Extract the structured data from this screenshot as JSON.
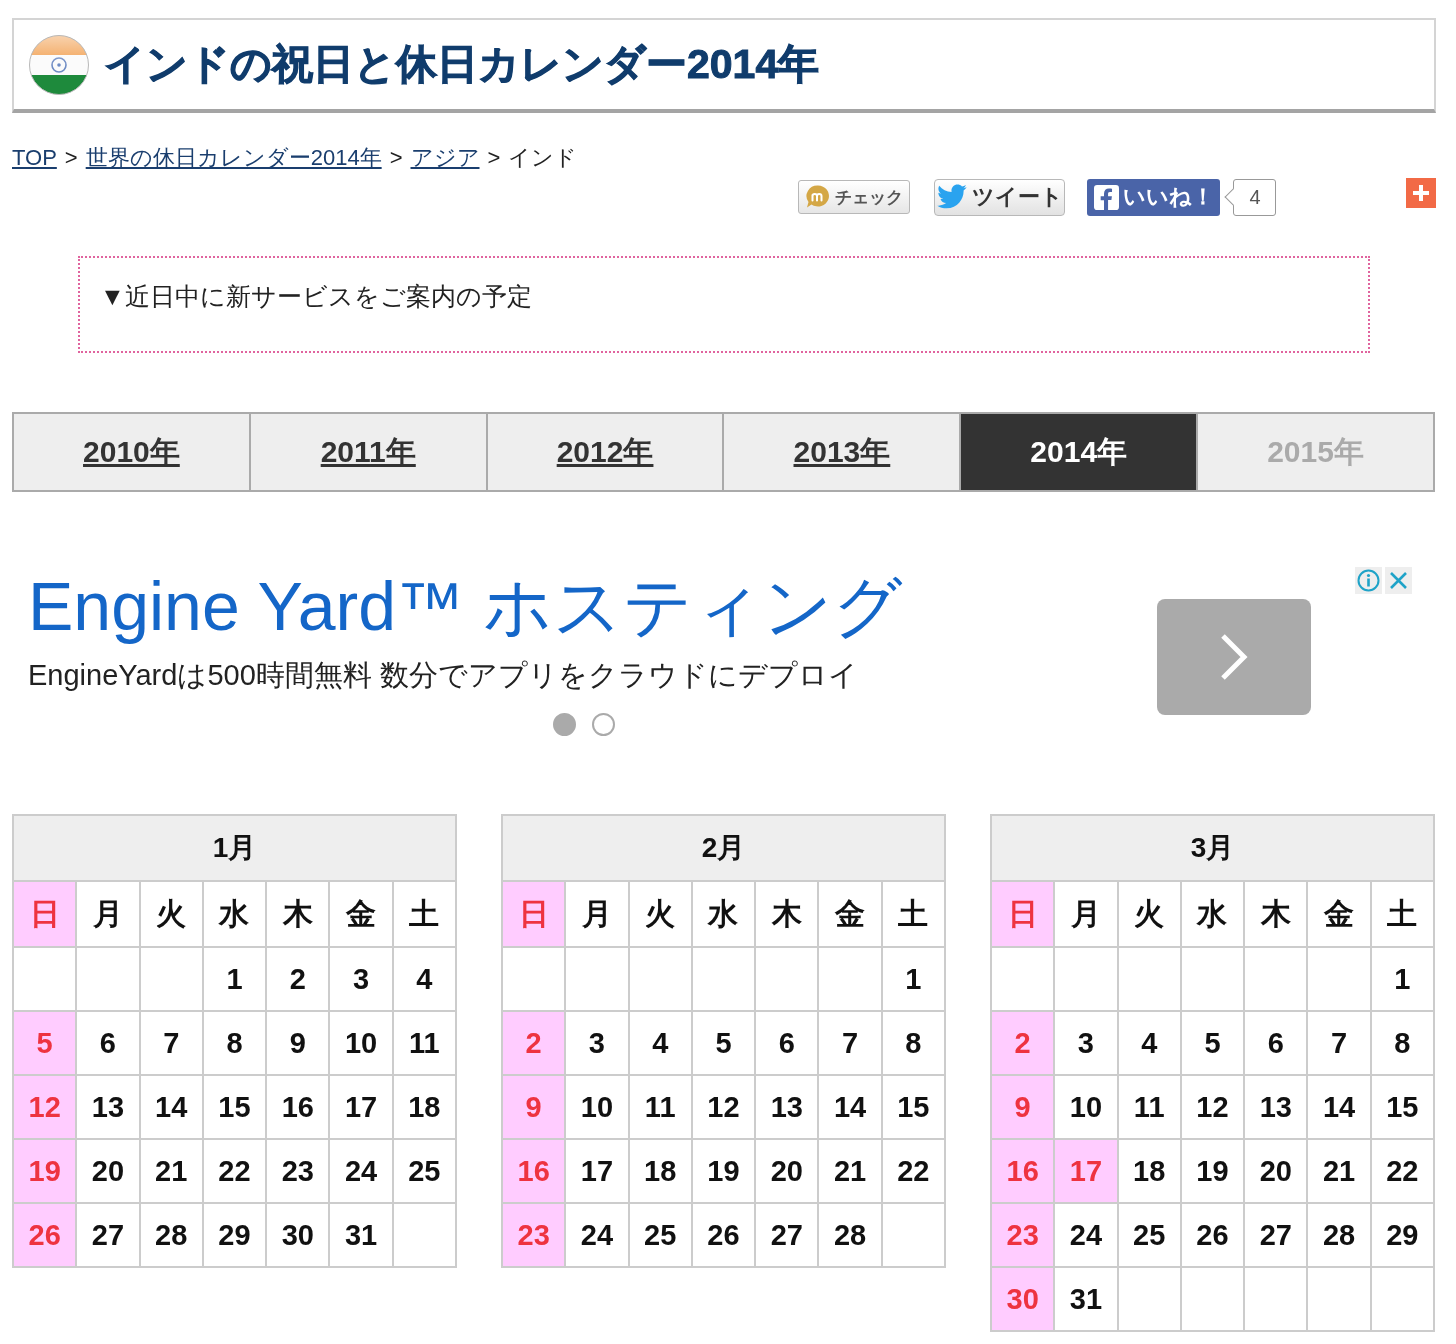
{
  "header": {
    "title": "インドの祝日と休日カレンダー2014年"
  },
  "breadcrumb": [
    {
      "label": "TOP",
      "kind": "link"
    },
    {
      "label": ">",
      "kind": "separator"
    },
    {
      "label": "世界の休日カレンダー2014年",
      "kind": "link"
    },
    {
      "label": ">",
      "kind": "separator"
    },
    {
      "label": "アジア",
      "kind": "link"
    },
    {
      "label": ">",
      "kind": "separator"
    },
    {
      "label": "インド",
      "kind": "current"
    }
  ],
  "share": {
    "buttons": [
      {
        "label": "チェック",
        "kind": "check"
      },
      {
        "label": "ツイート",
        "kind": "tweet"
      },
      {
        "label": "いいね！",
        "kind": "like"
      }
    ],
    "like_count": "4"
  },
  "notice": {
    "text": "▼近日中に新サービスをご案内の予定"
  },
  "year_tabs": [
    {
      "label": "2010年",
      "selected": false,
      "disabled": false
    },
    {
      "label": "2011年",
      "selected": false,
      "disabled": false
    },
    {
      "label": "2012年",
      "selected": false,
      "disabled": false
    },
    {
      "label": "2013年",
      "selected": false,
      "disabled": false
    },
    {
      "label": "2014年",
      "selected": true,
      "disabled": false
    },
    {
      "label": "2015年",
      "selected": false,
      "disabled": true
    }
  ],
  "ad": {
    "title": "Engine Yard™ ホスティング",
    "description": "EngineYardは500時間無料 数分でアプリをクラウドにデプロイ",
    "slides": [
      {
        "selected": true
      },
      {
        "selected": false
      }
    ]
  },
  "months": [
    {
      "title": "1月",
      "weekdays": [
        {
          "label": "日",
          "holiday": true
        },
        {
          "label": "月",
          "holiday": false
        },
        {
          "label": "火",
          "holiday": false
        },
        {
          "label": "水",
          "holiday": false
        },
        {
          "label": "木",
          "holiday": false
        },
        {
          "label": "金",
          "holiday": false
        },
        {
          "label": "土",
          "holiday": false
        }
      ],
      "weeks": [
        [
          {
            "kind": "blank"
          },
          {
            "kind": "blank"
          },
          {
            "kind": "blank"
          },
          {
            "kind": "day",
            "day": "1",
            "holiday": false
          },
          {
            "kind": "day",
            "day": "2",
            "holiday": false
          },
          {
            "kind": "day",
            "day": "3",
            "holiday": false
          },
          {
            "kind": "day",
            "day": "4",
            "holiday": false
          }
        ],
        [
          {
            "kind": "day",
            "day": "5",
            "holiday": true
          },
          {
            "kind": "day",
            "day": "6",
            "holiday": false
          },
          {
            "kind": "day",
            "day": "7",
            "holiday": false
          },
          {
            "kind": "day",
            "day": "8",
            "holiday": false
          },
          {
            "kind": "day",
            "day": "9",
            "holiday": false
          },
          {
            "kind": "day",
            "day": "10",
            "holiday": false
          },
          {
            "kind": "day",
            "day": "11",
            "holiday": false
          }
        ],
        [
          {
            "kind": "day",
            "day": "12",
            "holiday": true
          },
          {
            "kind": "day",
            "day": "13",
            "holiday": false
          },
          {
            "kind": "day",
            "day": "14",
            "holiday": false
          },
          {
            "kind": "day",
            "day": "15",
            "holiday": false
          },
          {
            "kind": "day",
            "day": "16",
            "holiday": false
          },
          {
            "kind": "day",
            "day": "17",
            "holiday": false
          },
          {
            "kind": "day",
            "day": "18",
            "holiday": false
          }
        ],
        [
          {
            "kind": "day",
            "day": "19",
            "holiday": true
          },
          {
            "kind": "day",
            "day": "20",
            "holiday": false
          },
          {
            "kind": "day",
            "day": "21",
            "holiday": false
          },
          {
            "kind": "day",
            "day": "22",
            "holiday": false
          },
          {
            "kind": "day",
            "day": "23",
            "holiday": false
          },
          {
            "kind": "day",
            "day": "24",
            "holiday": false
          },
          {
            "kind": "day",
            "day": "25",
            "holiday": false
          }
        ],
        [
          {
            "kind": "day",
            "day": "26",
            "holiday": true
          },
          {
            "kind": "day",
            "day": "27",
            "holiday": false
          },
          {
            "kind": "day",
            "day": "28",
            "holiday": false
          },
          {
            "kind": "day",
            "day": "29",
            "holiday": false
          },
          {
            "kind": "day",
            "day": "30",
            "holiday": false
          },
          {
            "kind": "day",
            "day": "31",
            "holiday": false
          },
          {
            "kind": "blank"
          }
        ]
      ]
    },
    {
      "title": "2月",
      "weekdays": [
        {
          "label": "日",
          "holiday": true
        },
        {
          "label": "月",
          "holiday": false
        },
        {
          "label": "火",
          "holiday": false
        },
        {
          "label": "水",
          "holiday": false
        },
        {
          "label": "木",
          "holiday": false
        },
        {
          "label": "金",
          "holiday": false
        },
        {
          "label": "土",
          "holiday": false
        }
      ],
      "weeks": [
        [
          {
            "kind": "blank"
          },
          {
            "kind": "blank"
          },
          {
            "kind": "blank"
          },
          {
            "kind": "blank"
          },
          {
            "kind": "blank"
          },
          {
            "kind": "blank"
          },
          {
            "kind": "day",
            "day": "1",
            "holiday": false
          }
        ],
        [
          {
            "kind": "day",
            "day": "2",
            "holiday": true
          },
          {
            "kind": "day",
            "day": "3",
            "holiday": false
          },
          {
            "kind": "day",
            "day": "4",
            "holiday": false
          },
          {
            "kind": "day",
            "day": "5",
            "holiday": false
          },
          {
            "kind": "day",
            "day": "6",
            "holiday": false
          },
          {
            "kind": "day",
            "day": "7",
            "holiday": false
          },
          {
            "kind": "day",
            "day": "8",
            "holiday": false
          }
        ],
        [
          {
            "kind": "day",
            "day": "9",
            "holiday": true
          },
          {
            "kind": "day",
            "day": "10",
            "holiday": false
          },
          {
            "kind": "day",
            "day": "11",
            "holiday": false
          },
          {
            "kind": "day",
            "day": "12",
            "holiday": false
          },
          {
            "kind": "day",
            "day": "13",
            "holiday": false
          },
          {
            "kind": "day",
            "day": "14",
            "holiday": false
          },
          {
            "kind": "day",
            "day": "15",
            "holiday": false
          }
        ],
        [
          {
            "kind": "day",
            "day": "16",
            "holiday": true
          },
          {
            "kind": "day",
            "day": "17",
            "holiday": false
          },
          {
            "kind": "day",
            "day": "18",
            "holiday": false
          },
          {
            "kind": "day",
            "day": "19",
            "holiday": false
          },
          {
            "kind": "day",
            "day": "20",
            "holiday": false
          },
          {
            "kind": "day",
            "day": "21",
            "holiday": false
          },
          {
            "kind": "day",
            "day": "22",
            "holiday": false
          }
        ],
        [
          {
            "kind": "day",
            "day": "23",
            "holiday": true
          },
          {
            "kind": "day",
            "day": "24",
            "holiday": false
          },
          {
            "kind": "day",
            "day": "25",
            "holiday": false
          },
          {
            "kind": "day",
            "day": "26",
            "holiday": false
          },
          {
            "kind": "day",
            "day": "27",
            "holiday": false
          },
          {
            "kind": "day",
            "day": "28",
            "holiday": false
          },
          {
            "kind": "blank"
          }
        ]
      ]
    },
    {
      "title": "3月",
      "weekdays": [
        {
          "label": "日",
          "holiday": true
        },
        {
          "label": "月",
          "holiday": false
        },
        {
          "label": "火",
          "holiday": false
        },
        {
          "label": "水",
          "holiday": false
        },
        {
          "label": "木",
          "holiday": false
        },
        {
          "label": "金",
          "holiday": false
        },
        {
          "label": "土",
          "holiday": false
        }
      ],
      "weeks": [
        [
          {
            "kind": "blank"
          },
          {
            "kind": "blank"
          },
          {
            "kind": "blank"
          },
          {
            "kind": "blank"
          },
          {
            "kind": "blank"
          },
          {
            "kind": "blank"
          },
          {
            "kind": "day",
            "day": "1",
            "holiday": false
          }
        ],
        [
          {
            "kind": "day",
            "day": "2",
            "holiday": true
          },
          {
            "kind": "day",
            "day": "3",
            "holiday": false
          },
          {
            "kind": "day",
            "day": "4",
            "holiday": false
          },
          {
            "kind": "day",
            "day": "5",
            "holiday": false
          },
          {
            "kind": "day",
            "day": "6",
            "holiday": false
          },
          {
            "kind": "day",
            "day": "7",
            "holiday": false
          },
          {
            "kind": "day",
            "day": "8",
            "holiday": false
          }
        ],
        [
          {
            "kind": "day",
            "day": "9",
            "holiday": true
          },
          {
            "kind": "day",
            "day": "10",
            "holiday": false
          },
          {
            "kind": "day",
            "day": "11",
            "holiday": false
          },
          {
            "kind": "day",
            "day": "12",
            "holiday": false
          },
          {
            "kind": "day",
            "day": "13",
            "holiday": false
          },
          {
            "kind": "day",
            "day": "14",
            "holiday": false
          },
          {
            "kind": "day",
            "day": "15",
            "holiday": false
          }
        ],
        [
          {
            "kind": "day",
            "day": "16",
            "holiday": true
          },
          {
            "kind": "day",
            "day": "17",
            "holiday": true
          },
          {
            "kind": "day",
            "day": "18",
            "holiday": false
          },
          {
            "kind": "day",
            "day": "19",
            "holiday": false
          },
          {
            "kind": "day",
            "day": "20",
            "holiday": false
          },
          {
            "kind": "day",
            "day": "21",
            "holiday": false
          },
          {
            "kind": "day",
            "day": "22",
            "holiday": false
          }
        ],
        [
          {
            "kind": "day",
            "day": "23",
            "holiday": true
          },
          {
            "kind": "day",
            "day": "24",
            "holiday": false
          },
          {
            "kind": "day",
            "day": "25",
            "holiday": false
          },
          {
            "kind": "day",
            "day": "26",
            "holiday": false
          },
          {
            "kind": "day",
            "day": "27",
            "holiday": false
          },
          {
            "kind": "day",
            "day": "28",
            "holiday": false
          },
          {
            "kind": "day",
            "day": "29",
            "holiday": false
          }
        ],
        [
          {
            "kind": "day",
            "day": "30",
            "holiday": true
          },
          {
            "kind": "day",
            "day": "31",
            "holiday": false
          },
          {
            "kind": "blank"
          },
          {
            "kind": "blank"
          },
          {
            "kind": "blank"
          },
          {
            "kind": "blank"
          },
          {
            "kind": "blank"
          }
        ]
      ]
    }
  ]
}
